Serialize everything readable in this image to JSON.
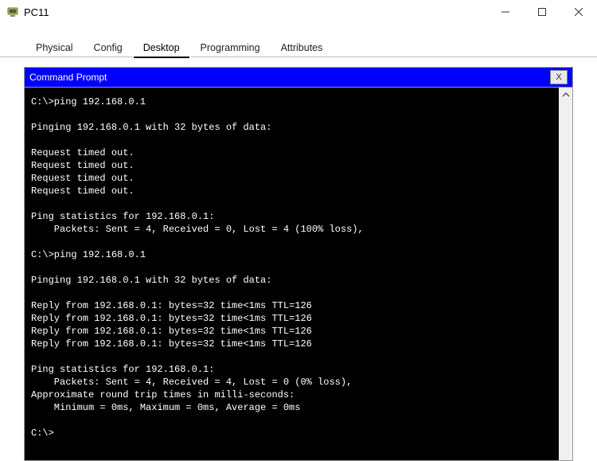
{
  "window": {
    "title": "PC11"
  },
  "tabs": [
    {
      "label": "Physical",
      "active": false
    },
    {
      "label": "Config",
      "active": false
    },
    {
      "label": "Desktop",
      "active": true
    },
    {
      "label": "Programming",
      "active": false
    },
    {
      "label": "Attributes",
      "active": false
    }
  ],
  "cmd": {
    "title": "Command Prompt",
    "close": "X",
    "lines": [
      "C:\\>ping 192.168.0.1",
      "",
      "Pinging 192.168.0.1 with 32 bytes of data:",
      "",
      "Request timed out.",
      "Request timed out.",
      "Request timed out.",
      "Request timed out.",
      "",
      "Ping statistics for 192.168.0.1:",
      "    Packets: Sent = 4, Received = 0, Lost = 4 (100% loss),",
      "",
      "C:\\>ping 192.168.0.1",
      "",
      "Pinging 192.168.0.1 with 32 bytes of data:",
      "",
      "Reply from 192.168.0.1: bytes=32 time<1ms TTL=126",
      "Reply from 192.168.0.1: bytes=32 time<1ms TTL=126",
      "Reply from 192.168.0.1: bytes=32 time<1ms TTL=126",
      "Reply from 192.168.0.1: bytes=32 time<1ms TTL=126",
      "",
      "Ping statistics for 192.168.0.1:",
      "    Packets: Sent = 4, Received = 4, Lost = 0 (0% loss),",
      "Approximate round trip times in milli-seconds:",
      "    Minimum = 0ms, Maximum = 0ms, Average = 0ms",
      "",
      "C:\\>"
    ]
  }
}
